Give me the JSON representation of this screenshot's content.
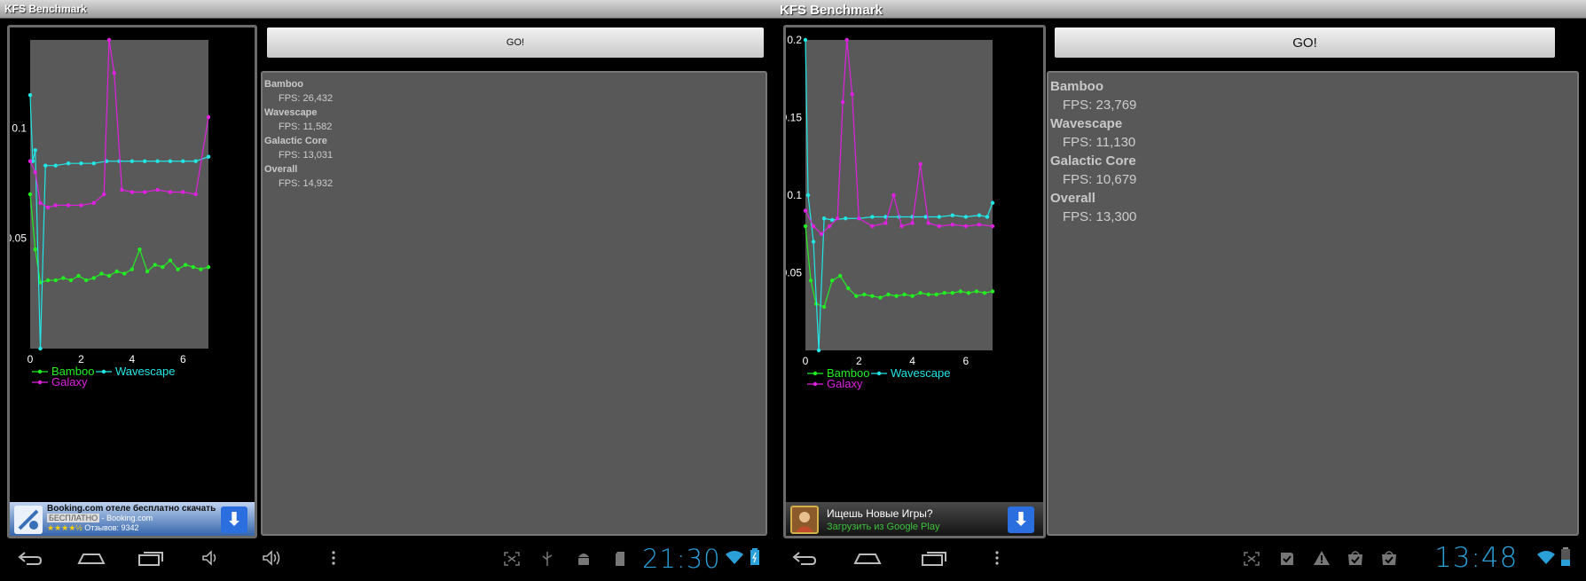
{
  "screens": [
    {
      "app_title": "KFS Benchmark",
      "go_label": "GO!",
      "results": [
        {
          "name": "Bamboo",
          "fps": "FPS: 26,432"
        },
        {
          "name": "Wavescape",
          "fps": "FPS: 11,582"
        },
        {
          "name": "Galactic Core",
          "fps": "FPS: 13,031"
        },
        {
          "name": "Overall",
          "fps": "FPS: 14,932"
        }
      ],
      "chart": {
        "y_ticks": [
          "0.1",
          "0.05"
        ],
        "x_ticks": [
          "0",
          "2",
          "4",
          "6"
        ],
        "legend": [
          "Bamboo",
          "Wavescape",
          "Galaxy"
        ]
      },
      "ad": {
        "title": "Booking.com отеле бесплатно скачать",
        "badge": "БЕСПЛАТНО",
        "source": "- Booking.com",
        "reviews": "Отзывов: 9342",
        "stars": "★★★★½",
        "download_icon": "download-arrow-icon"
      },
      "navbar": {
        "clock": "21:30",
        "icons": [
          "back-icon",
          "home-icon",
          "recent-apps-icon",
          "volume-icon",
          "volume-icon",
          "menu-icon",
          "screenshot-icon",
          "usb-icon",
          "android-debug-icon",
          "sd-card-icon",
          "wifi-icon",
          "battery-icon"
        ]
      }
    },
    {
      "app_title": "KFS Benchmark",
      "go_label": "GO!",
      "results": [
        {
          "name": "Bamboo",
          "fps": "FPS: 23,769"
        },
        {
          "name": "Wavescape",
          "fps": "FPS: 11,130"
        },
        {
          "name": "Galactic Core",
          "fps": "FPS: 10,679"
        },
        {
          "name": "Overall",
          "fps": "FPS: 13,300"
        }
      ],
      "chart": {
        "y_ticks": [
          "0.2",
          "0.15",
          "0.1",
          "0.05"
        ],
        "x_ticks": [
          "0",
          "2",
          "4",
          "6"
        ],
        "legend": [
          "Bamboo",
          "Wavescape",
          "Galaxy"
        ]
      },
      "ad": {
        "title": "Ищешь Новые Игры?",
        "source": "Загрузить из Google Play",
        "download_icon": "download-arrow-icon"
      },
      "navbar": {
        "clock": "13:48",
        "icons": [
          "back-icon",
          "home-icon",
          "recent-apps-icon",
          "menu-icon",
          "screenshot-icon",
          "task-check-icon",
          "warning-icon",
          "bag-check-icon",
          "bag-check-icon",
          "wifi-icon",
          "battery-icon"
        ]
      }
    }
  ],
  "colors": {
    "bamboo": "#22ee22",
    "wavescape": "#22e6e6",
    "galaxy": "#e020e0",
    "plot_bg": "#595959",
    "clock": "#2a9fd8"
  },
  "chart_data": [
    {
      "type": "line",
      "title": "",
      "xlabel": "",
      "ylabel": "",
      "xlim": [
        0,
        7
      ],
      "ylim": [
        0,
        0.14
      ],
      "x_ticks": [
        0,
        2,
        4,
        6
      ],
      "y_ticks": [
        0.05,
        0.1
      ],
      "legend_position": "bottom",
      "series": [
        {
          "name": "Bamboo",
          "x": [
            0,
            0.2,
            0.4,
            0.7,
            1.0,
            1.3,
            1.6,
            1.9,
            2.2,
            2.5,
            2.8,
            3.1,
            3.4,
            3.7,
            4.0,
            4.3,
            4.6,
            4.9,
            5.2,
            5.5,
            5.8,
            6.1,
            6.4,
            6.7,
            7.0
          ],
          "values": [
            0.07,
            0.045,
            0.03,
            0.031,
            0.031,
            0.032,
            0.031,
            0.033,
            0.031,
            0.032,
            0.034,
            0.033,
            0.035,
            0.034,
            0.036,
            0.045,
            0.035,
            0.038,
            0.037,
            0.04,
            0.036,
            0.038,
            0.037,
            0.036,
            0.037
          ]
        },
        {
          "name": "Wavescape",
          "x": [
            0,
            0.1,
            0.2,
            0.4,
            0.6,
            1.0,
            1.5,
            2.0,
            2.5,
            3.0,
            3.5,
            4.0,
            4.5,
            5.0,
            5.5,
            6.0,
            6.5,
            7.0
          ],
          "values": [
            0.115,
            0.085,
            0.09,
            0.0,
            0.083,
            0.083,
            0.084,
            0.084,
            0.084,
            0.085,
            0.085,
            0.085,
            0.085,
            0.085,
            0.085,
            0.085,
            0.085,
            0.087
          ]
        },
        {
          "name": "Galaxy",
          "x": [
            0,
            0.2,
            0.4,
            0.7,
            1.0,
            1.5,
            2.0,
            2.5,
            2.9,
            3.1,
            3.3,
            3.6,
            4.0,
            4.5,
            5.0,
            5.5,
            6.0,
            6.5,
            7.0
          ],
          "values": [
            0.085,
            0.08,
            0.066,
            0.064,
            0.065,
            0.065,
            0.065,
            0.066,
            0.07,
            0.14,
            0.125,
            0.072,
            0.071,
            0.071,
            0.072,
            0.071,
            0.071,
            0.07,
            0.105
          ]
        }
      ]
    },
    {
      "type": "line",
      "title": "",
      "xlabel": "",
      "ylabel": "",
      "xlim": [
        0,
        7
      ],
      "ylim": [
        0,
        0.2
      ],
      "x_ticks": [
        0,
        2,
        4,
        6
      ],
      "y_ticks": [
        0.05,
        0.1,
        0.15,
        0.2
      ],
      "legend_position": "bottom",
      "series": [
        {
          "name": "Bamboo",
          "x": [
            0,
            0.2,
            0.4,
            0.7,
            1.0,
            1.3,
            1.6,
            1.9,
            2.2,
            2.5,
            2.8,
            3.1,
            3.4,
            3.7,
            4.0,
            4.3,
            4.6,
            4.9,
            5.2,
            5.5,
            5.8,
            6.1,
            6.4,
            6.7,
            7.0
          ],
          "values": [
            0.08,
            0.045,
            0.03,
            0.028,
            0.045,
            0.048,
            0.04,
            0.035,
            0.036,
            0.035,
            0.034,
            0.036,
            0.035,
            0.036,
            0.035,
            0.037,
            0.036,
            0.036,
            0.037,
            0.037,
            0.038,
            0.037,
            0.038,
            0.037,
            0.038
          ]
        },
        {
          "name": "Wavescape",
          "x": [
            0,
            0.1,
            0.3,
            0.5,
            0.7,
            1.0,
            1.5,
            2.0,
            2.5,
            3.0,
            3.5,
            4.0,
            4.5,
            5.0,
            5.5,
            6.0,
            6.5,
            6.8,
            7.0
          ],
          "values": [
            0.2,
            0.1,
            0.07,
            0.0,
            0.085,
            0.084,
            0.085,
            0.085,
            0.086,
            0.086,
            0.086,
            0.086,
            0.086,
            0.086,
            0.087,
            0.086,
            0.087,
            0.086,
            0.095
          ]
        },
        {
          "name": "Galaxy",
          "x": [
            0,
            0.3,
            0.6,
            0.9,
            1.2,
            1.4,
            1.55,
            1.75,
            2.0,
            2.5,
            3.0,
            3.3,
            3.6,
            4.0,
            4.3,
            4.6,
            5.0,
            5.5,
            6.0,
            6.5,
            7.0
          ],
          "values": [
            0.09,
            0.08,
            0.075,
            0.08,
            0.085,
            0.16,
            0.2,
            0.165,
            0.085,
            0.08,
            0.082,
            0.1,
            0.08,
            0.082,
            0.12,
            0.082,
            0.08,
            0.081,
            0.08,
            0.081,
            0.08
          ]
        }
      ]
    }
  ]
}
